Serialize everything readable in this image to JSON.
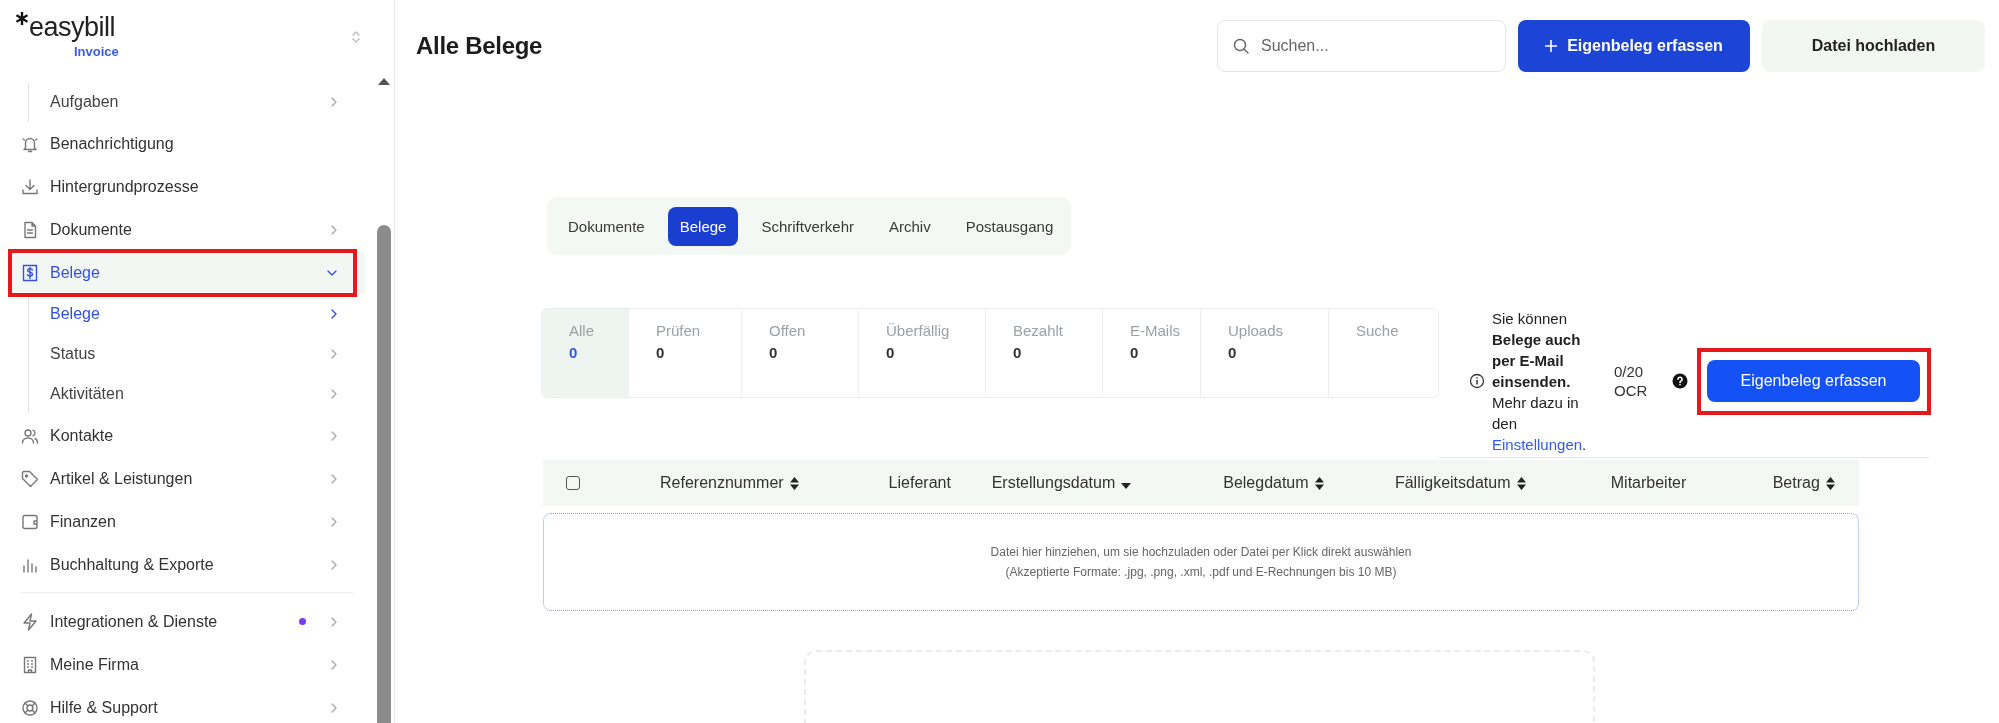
{
  "sidebar": {
    "logo": {
      "name": "easybill",
      "product": "Invoice"
    },
    "items": [
      {
        "label": "Aufgaben",
        "kind": "sub",
        "selected": false,
        "chevron": true
      },
      {
        "label": "Benachrichtigung",
        "kind": "item",
        "selected": false,
        "chevron": false,
        "highlighted": false
      },
      {
        "label": "Hintergrundprozesse",
        "kind": "item",
        "selected": false,
        "chevron": false,
        "highlighted": false
      },
      {
        "label": "Dokumente",
        "kind": "item",
        "selected": false,
        "chevron": true,
        "expanded": false,
        "highlighted": false
      },
      {
        "label": "Belege",
        "kind": "item",
        "selected": true,
        "chevron": true,
        "expanded": true,
        "highlighted": true,
        "children": [
          {
            "label": "Belege",
            "selected": true
          },
          {
            "label": "Status",
            "selected": false
          },
          {
            "label": "Aktivitäten",
            "selected": false
          }
        ]
      },
      {
        "label": "Kontakte",
        "kind": "item",
        "selected": false,
        "chevron": true,
        "expanded": false,
        "highlighted": false
      },
      {
        "label": "Artikel & Leistungen",
        "kind": "item",
        "selected": false,
        "chevron": true,
        "expanded": false,
        "highlighted": false
      },
      {
        "label": "Finanzen",
        "kind": "item",
        "selected": false,
        "chevron": true,
        "expanded": false,
        "highlighted": false
      },
      {
        "label": "Buchhaltung & Exporte",
        "kind": "item",
        "selected": false,
        "chevron": true,
        "expanded": false,
        "highlighted": false
      }
    ],
    "footer_items": [
      {
        "label": "Integrationen & Dienste",
        "notification": true
      },
      {
        "label": "Meine Firma",
        "notification": false
      },
      {
        "label": "Hilfe & Support",
        "notification": false
      }
    ]
  },
  "header": {
    "title": "Alle Belege",
    "search": {
      "placeholder": "Suchen..."
    },
    "buttons": [
      {
        "label": "Eigenbeleg erfassen",
        "kind": "primary"
      },
      {
        "label": "Datei hochladen",
        "kind": "secondary"
      }
    ]
  },
  "doc_tabs": [
    {
      "label": "Dokumente",
      "selected": false
    },
    {
      "label": "Belege",
      "selected": true
    },
    {
      "label": "Schriftverkehr",
      "selected": false
    },
    {
      "label": "Archiv",
      "selected": false
    },
    {
      "label": "Postausgang",
      "selected": false
    }
  ],
  "filter_tabs": [
    {
      "label": "Alle",
      "count": "0",
      "selected": true
    },
    {
      "label": "Prüfen",
      "count": "0",
      "selected": false
    },
    {
      "label": "Offen",
      "count": "0",
      "selected": false
    },
    {
      "label": "Überfällig",
      "count": "0",
      "selected": false
    },
    {
      "label": "Bezahlt",
      "count": "0",
      "selected": false
    },
    {
      "label": "E-Mails",
      "count": "0",
      "selected": false
    },
    {
      "label": "Uploads",
      "count": "0",
      "selected": false
    },
    {
      "label": "Suche",
      "selected": false
    }
  ],
  "info": {
    "text": "Sie können **Belege auch per E-Mail einsenden.** Mehr dazu in den",
    "link": "Einstellungen",
    "after_link": ".",
    "ocr": "0/20 OCR",
    "button": {
      "label": "Eigenbeleg erfassen",
      "highlighted": true
    }
  },
  "table": {
    "select_all": {
      "checked": false
    },
    "columns": [
      {
        "label": "Referenznummer",
        "sortable": true,
        "sorted": false
      },
      {
        "label": "Lieferant",
        "sortable": false
      },
      {
        "label": "Erstellungsdatum",
        "sortable": true,
        "sorted": true
      },
      {
        "label": "Belegdatum",
        "sortable": true,
        "sorted": false
      },
      {
        "label": "Fälligkeitsdatum",
        "sortable": true,
        "sorted": false
      },
      {
        "label": "Mitarbeiter",
        "sortable": false
      },
      {
        "label": "Betrag",
        "sortable": true,
        "sorted": false
      }
    ],
    "drop_zone": {
      "line_1": "Datei hier hinziehen, um sie hochzuladen oder Datei per Klick direkt auswählen",
      "line_2": "(Akzeptierte Formate: .jpg, .png, .xml, .pdf und E-Rechnungen bis 10 MB)"
    }
  }
}
